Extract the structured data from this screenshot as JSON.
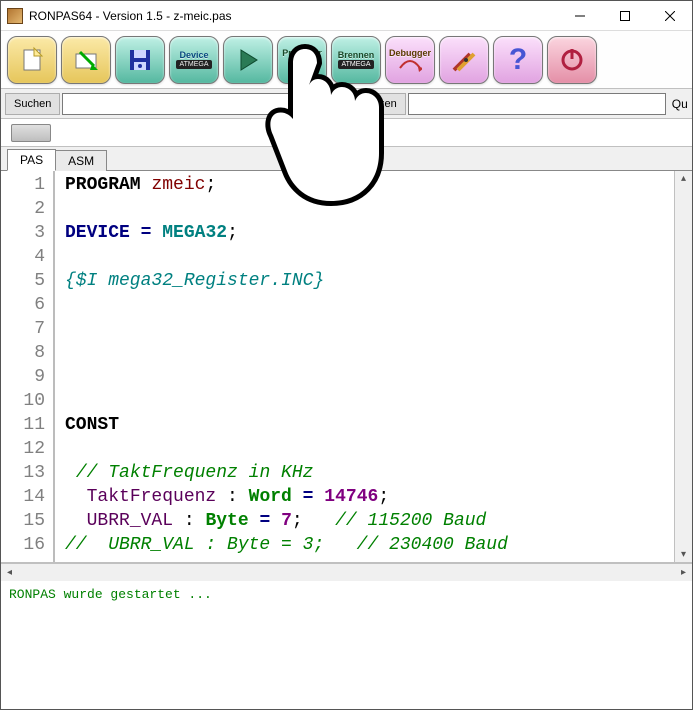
{
  "window": {
    "title": "RONPAS64 - Version 1.5 - z-meic.pas"
  },
  "toolbar": {
    "items": [
      {
        "name": "new-button",
        "label": ""
      },
      {
        "name": "open-button",
        "label": ""
      },
      {
        "name": "save-button",
        "label": ""
      },
      {
        "name": "device-button",
        "label": "Device"
      },
      {
        "name": "run-button",
        "label": ""
      },
      {
        "name": "prommer-button",
        "label": "Prommer"
      },
      {
        "name": "brennen-button",
        "label": "Brennen"
      },
      {
        "name": "debugger-button",
        "label": "Debugger"
      },
      {
        "name": "tools-button",
        "label": ""
      },
      {
        "name": "help-button",
        "label": ""
      },
      {
        "name": "power-button",
        "label": ""
      }
    ],
    "device_sub": "ATMEGA",
    "brennen_sub": "ATMEGA"
  },
  "search": {
    "suchen_label": "Suchen",
    "ersetzen_label": "Ersetzen",
    "search_value": "",
    "replace_value": "",
    "extra_label": "Qu"
  },
  "tabs": {
    "items": [
      {
        "label": "PAS",
        "active": true
      },
      {
        "label": "ASM",
        "active": false
      }
    ]
  },
  "editor": {
    "first_line": 1,
    "lines": [
      {
        "html": "<span class='kw-bold'>PROGRAM</span> <span class='ident'>zmeic</span>;"
      },
      {
        "html": ""
      },
      {
        "html": "<span class='kw-navy-bold'>DEVICE</span> <span class='kw-navy-bold'>=</span> <span class='kw-teal-bold'>MEGA32</span>;"
      },
      {
        "html": ""
      },
      {
        "html": "<span class='comment-teal'>{$I mega32_Register.INC}</span>"
      },
      {
        "html": ""
      },
      {
        "html": ""
      },
      {
        "html": ""
      },
      {
        "html": ""
      },
      {
        "html": ""
      },
      {
        "html": "<span class='kw-bold'>CONST</span>"
      },
      {
        "html": ""
      },
      {
        "html": " <span class='comment-green'>// TaktFrequenz in KHz</span>"
      },
      {
        "html": "  <span class='ident-purple'>TaktFrequenz</span> : <span class='kw-green-bold'>Word</span> <span class='kw-navy-bold'>=</span> <span class='num'>14746</span>;"
      },
      {
        "html": "  <span class='ident-purple'>UBRR_VAL</span> : <span class='kw-green-bold'>Byte</span> <span class='kw-navy-bold'>=</span> <span class='num'>7</span>;   <span class='comment-green'>// 115200 Baud</span>"
      },
      {
        "html": "<span class='comment-green'>//  UBRR_VAL : Byte = 3;   // 230400 Baud</span>"
      }
    ]
  },
  "console": {
    "text": "RONPAS wurde gestartet ..."
  },
  "chart_data": null
}
